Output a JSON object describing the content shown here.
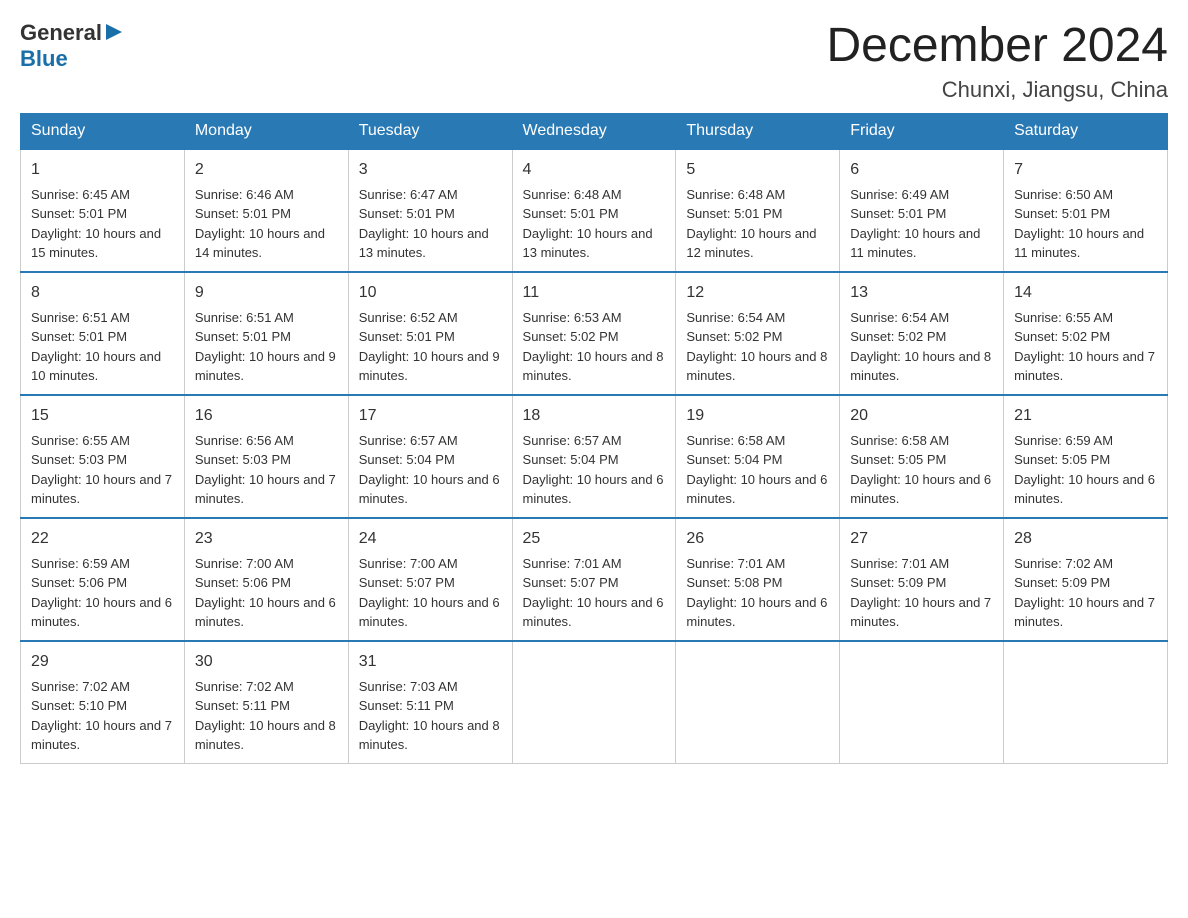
{
  "header": {
    "logo_general": "General",
    "logo_blue": "Blue",
    "title": "December 2024",
    "subtitle": "Chunxi, Jiangsu, China"
  },
  "weekdays": [
    "Sunday",
    "Monday",
    "Tuesday",
    "Wednesday",
    "Thursday",
    "Friday",
    "Saturday"
  ],
  "weeks": [
    [
      {
        "day": "1",
        "sunrise": "6:45 AM",
        "sunset": "5:01 PM",
        "daylight": "10 hours and 15 minutes."
      },
      {
        "day": "2",
        "sunrise": "6:46 AM",
        "sunset": "5:01 PM",
        "daylight": "10 hours and 14 minutes."
      },
      {
        "day": "3",
        "sunrise": "6:47 AM",
        "sunset": "5:01 PM",
        "daylight": "10 hours and 13 minutes."
      },
      {
        "day": "4",
        "sunrise": "6:48 AM",
        "sunset": "5:01 PM",
        "daylight": "10 hours and 13 minutes."
      },
      {
        "day": "5",
        "sunrise": "6:48 AM",
        "sunset": "5:01 PM",
        "daylight": "10 hours and 12 minutes."
      },
      {
        "day": "6",
        "sunrise": "6:49 AM",
        "sunset": "5:01 PM",
        "daylight": "10 hours and 11 minutes."
      },
      {
        "day": "7",
        "sunrise": "6:50 AM",
        "sunset": "5:01 PM",
        "daylight": "10 hours and 11 minutes."
      }
    ],
    [
      {
        "day": "8",
        "sunrise": "6:51 AM",
        "sunset": "5:01 PM",
        "daylight": "10 hours and 10 minutes."
      },
      {
        "day": "9",
        "sunrise": "6:51 AM",
        "sunset": "5:01 PM",
        "daylight": "10 hours and 9 minutes."
      },
      {
        "day": "10",
        "sunrise": "6:52 AM",
        "sunset": "5:01 PM",
        "daylight": "10 hours and 9 minutes."
      },
      {
        "day": "11",
        "sunrise": "6:53 AM",
        "sunset": "5:02 PM",
        "daylight": "10 hours and 8 minutes."
      },
      {
        "day": "12",
        "sunrise": "6:54 AM",
        "sunset": "5:02 PM",
        "daylight": "10 hours and 8 minutes."
      },
      {
        "day": "13",
        "sunrise": "6:54 AM",
        "sunset": "5:02 PM",
        "daylight": "10 hours and 8 minutes."
      },
      {
        "day": "14",
        "sunrise": "6:55 AM",
        "sunset": "5:02 PM",
        "daylight": "10 hours and 7 minutes."
      }
    ],
    [
      {
        "day": "15",
        "sunrise": "6:55 AM",
        "sunset": "5:03 PM",
        "daylight": "10 hours and 7 minutes."
      },
      {
        "day": "16",
        "sunrise": "6:56 AM",
        "sunset": "5:03 PM",
        "daylight": "10 hours and 7 minutes."
      },
      {
        "day": "17",
        "sunrise": "6:57 AM",
        "sunset": "5:04 PM",
        "daylight": "10 hours and 6 minutes."
      },
      {
        "day": "18",
        "sunrise": "6:57 AM",
        "sunset": "5:04 PM",
        "daylight": "10 hours and 6 minutes."
      },
      {
        "day": "19",
        "sunrise": "6:58 AM",
        "sunset": "5:04 PM",
        "daylight": "10 hours and 6 minutes."
      },
      {
        "day": "20",
        "sunrise": "6:58 AM",
        "sunset": "5:05 PM",
        "daylight": "10 hours and 6 minutes."
      },
      {
        "day": "21",
        "sunrise": "6:59 AM",
        "sunset": "5:05 PM",
        "daylight": "10 hours and 6 minutes."
      }
    ],
    [
      {
        "day": "22",
        "sunrise": "6:59 AM",
        "sunset": "5:06 PM",
        "daylight": "10 hours and 6 minutes."
      },
      {
        "day": "23",
        "sunrise": "7:00 AM",
        "sunset": "5:06 PM",
        "daylight": "10 hours and 6 minutes."
      },
      {
        "day": "24",
        "sunrise": "7:00 AM",
        "sunset": "5:07 PM",
        "daylight": "10 hours and 6 minutes."
      },
      {
        "day": "25",
        "sunrise": "7:01 AM",
        "sunset": "5:07 PM",
        "daylight": "10 hours and 6 minutes."
      },
      {
        "day": "26",
        "sunrise": "7:01 AM",
        "sunset": "5:08 PM",
        "daylight": "10 hours and 6 minutes."
      },
      {
        "day": "27",
        "sunrise": "7:01 AM",
        "sunset": "5:09 PM",
        "daylight": "10 hours and 7 minutes."
      },
      {
        "day": "28",
        "sunrise": "7:02 AM",
        "sunset": "5:09 PM",
        "daylight": "10 hours and 7 minutes."
      }
    ],
    [
      {
        "day": "29",
        "sunrise": "7:02 AM",
        "sunset": "5:10 PM",
        "daylight": "10 hours and 7 minutes."
      },
      {
        "day": "30",
        "sunrise": "7:02 AM",
        "sunset": "5:11 PM",
        "daylight": "10 hours and 8 minutes."
      },
      {
        "day": "31",
        "sunrise": "7:03 AM",
        "sunset": "5:11 PM",
        "daylight": "10 hours and 8 minutes."
      },
      null,
      null,
      null,
      null
    ]
  ]
}
